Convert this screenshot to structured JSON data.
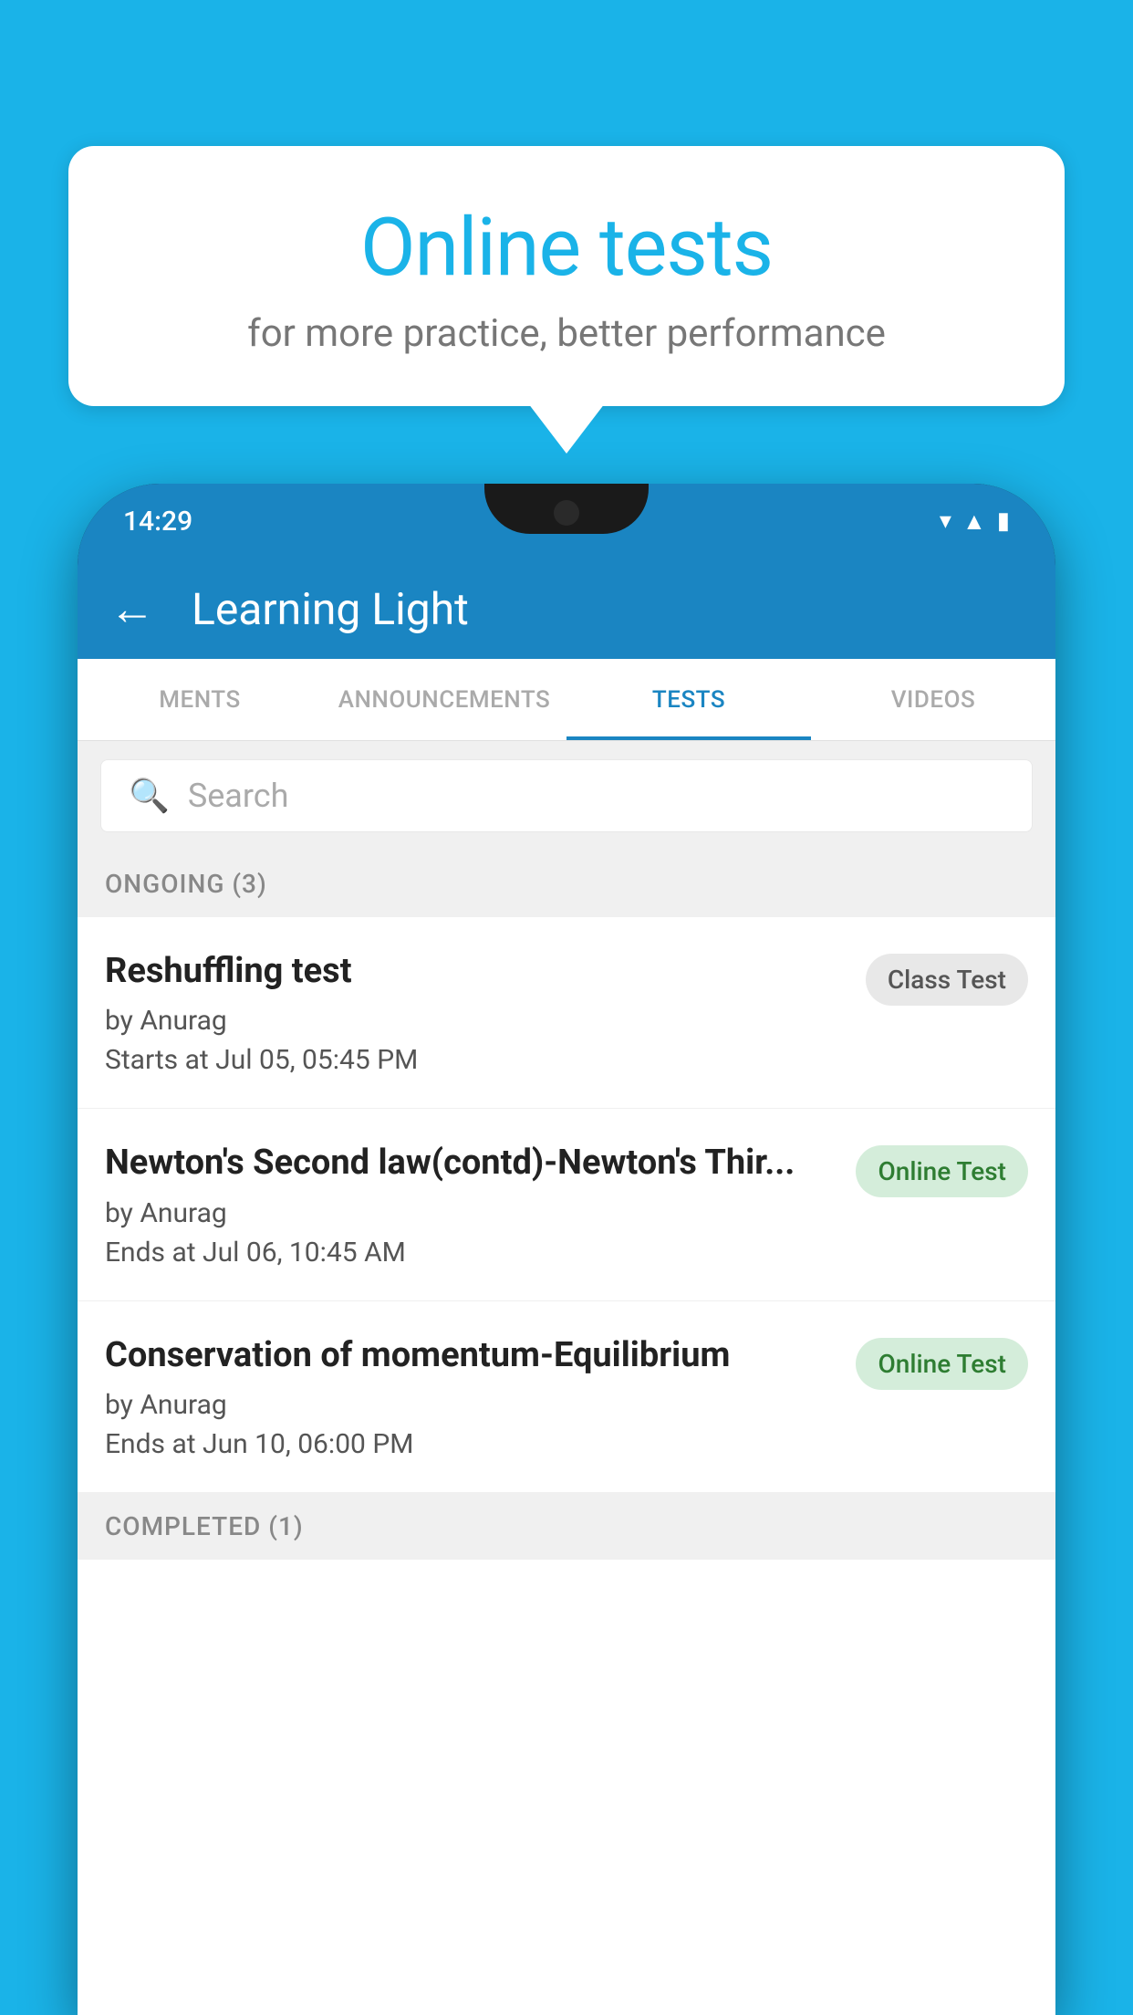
{
  "background_color": "#1ab3e8",
  "speech_bubble": {
    "title": "Online tests",
    "subtitle": "for more practice, better performance"
  },
  "phone": {
    "status_bar": {
      "time": "14:29",
      "icons": [
        "wifi",
        "signal",
        "battery"
      ]
    },
    "toolbar": {
      "back_label": "←",
      "title": "Learning Light"
    },
    "tabs": [
      {
        "label": "MENTS",
        "active": false
      },
      {
        "label": "ANNOUNCEMENTS",
        "active": false
      },
      {
        "label": "TESTS",
        "active": true
      },
      {
        "label": "VIDEOS",
        "active": false
      }
    ],
    "search": {
      "placeholder": "Search"
    },
    "sections": [
      {
        "title": "ONGOING (3)",
        "tests": [
          {
            "name": "Reshuffling test",
            "author": "by Anurag",
            "time": "Starts at  Jul 05, 05:45 PM",
            "badge": "Class Test",
            "badge_type": "class"
          },
          {
            "name": "Newton's Second law(contd)-Newton's Thir...",
            "author": "by Anurag",
            "time": "Ends at  Jul 06, 10:45 AM",
            "badge": "Online Test",
            "badge_type": "online"
          },
          {
            "name": "Conservation of momentum-Equilibrium",
            "author": "by Anurag",
            "time": "Ends at  Jun 10, 06:00 PM",
            "badge": "Online Test",
            "badge_type": "online"
          }
        ]
      },
      {
        "title": "COMPLETED (1)",
        "tests": []
      }
    ]
  }
}
